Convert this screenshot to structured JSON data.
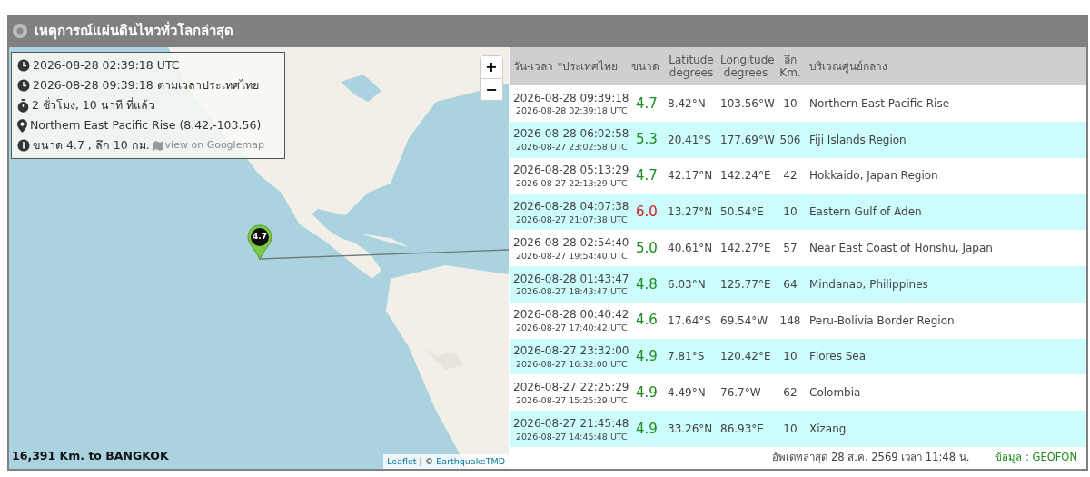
{
  "title": "เหตุการณ์แผ่นดินไหวทั่วโลกล่าสุด",
  "map": {
    "info": {
      "utc_time": "2026-08-28 02:39:18 UTC",
      "thai_time": "2026-08-28 09:39:18 ตามเวลาประเทศไทย",
      "elapsed": "2 ชั่วโมง, 10 นาที ที่แล้ว",
      "location": "Northern East Pacific Rise (8.42,-103.56)",
      "magnitude_depth": "ขนาด 4.7 , ลึก 10 กม.",
      "map_link": "view on Googlemap"
    },
    "zoom_in": "+",
    "zoom_out": "−",
    "marker_label": "4.7",
    "distance": "16,391 Km. to BANGKOK",
    "attribution_link": "Leaflet",
    "attribution_separator": "| ©",
    "attribution_source": "EarthquakeTMD"
  },
  "table": {
    "columns": [
      {
        "lines": [
          "วัน-เวลา *ประเทศไทย"
        ]
      },
      {
        "lines": [
          "ขนาด"
        ]
      },
      {
        "lines": [
          "Latitude",
          "degrees"
        ]
      },
      {
        "lines": [
          "Longitude",
          "degrees"
        ]
      },
      {
        "lines": [
          "ลึก",
          "Km."
        ]
      },
      {
        "lines": [
          "บริเวณศูนย์กลาง"
        ]
      }
    ],
    "rows": [
      {
        "local_time": "2026-08-28 09:39:18",
        "utc_time": "2026-08-28 02:39:18 UTC",
        "magnitude": "4.7",
        "color": "#1e8c1e",
        "latitude": "8.42°N",
        "longitude": "103.56°W",
        "depth": "10",
        "region": "Northern East Pacific Rise"
      },
      {
        "local_time": "2026-08-28 06:02:58",
        "utc_time": "2026-08-27 23:02:58 UTC",
        "magnitude": "5.3",
        "color": "#1e8c1e",
        "latitude": "20.41°S",
        "longitude": "177.69°W",
        "depth": "506",
        "region": "Fiji Islands Region"
      },
      {
        "local_time": "2026-08-28 05:13:29",
        "utc_time": "2026-08-27 22:13:29 UTC",
        "magnitude": "4.7",
        "color": "#1e8c1e",
        "latitude": "42.17°N",
        "longitude": "142.24°E",
        "depth": "42",
        "region": "Hokkaido, Japan Region"
      },
      {
        "local_time": "2026-08-28 04:07:38",
        "utc_time": "2026-08-27 21:07:38 UTC",
        "magnitude": "6.0",
        "color": "#cc1f1f",
        "latitude": "13.27°N",
        "longitude": "50.54°E",
        "depth": "10",
        "region": "Eastern Gulf of Aden"
      },
      {
        "local_time": "2026-08-28 02:54:40",
        "utc_time": "2026-08-27 19:54:40 UTC",
        "magnitude": "5.0",
        "color": "#1e8c1e",
        "latitude": "40.61°N",
        "longitude": "142.27°E",
        "depth": "57",
        "region": "Near East Coast of Honshu, Japan"
      },
      {
        "local_time": "2026-08-28 01:43:47",
        "utc_time": "2026-08-27 18:43:47 UTC",
        "magnitude": "4.8",
        "color": "#1e8c1e",
        "latitude": "6.03°N",
        "longitude": "125.77°E",
        "depth": "64",
        "region": "Mindanao, Philippines"
      },
      {
        "local_time": "2026-08-28 00:40:42",
        "utc_time": "2026-08-27 17:40:42 UTC",
        "magnitude": "4.6",
        "color": "#1e8c1e",
        "latitude": "17.64°S",
        "longitude": "69.54°W",
        "depth": "148",
        "region": "Peru-Bolivia Border Region"
      },
      {
        "local_time": "2026-08-27 23:32:00",
        "utc_time": "2026-08-27 16:32:00 UTC",
        "magnitude": "4.9",
        "color": "#1e8c1e",
        "latitude": "7.81°S",
        "longitude": "120.42°E",
        "depth": "10",
        "region": "Flores Sea"
      },
      {
        "local_time": "2026-08-27 22:25:29",
        "utc_time": "2026-08-27 15:25:29 UTC",
        "magnitude": "4.9",
        "color": "#1e8c1e",
        "latitude": "4.49°N",
        "longitude": "76.7°W",
        "depth": "62",
        "region": "Colombia"
      },
      {
        "local_time": "2026-08-27 21:45:48",
        "utc_time": "2026-08-27 14:45:48 UTC",
        "magnitude": "4.9",
        "color": "#1e8c1e",
        "latitude": "33.26°N",
        "longitude": "86.93°E",
        "depth": "10",
        "region": "Xizang"
      }
    ]
  },
  "footer": {
    "updated": "อัพเดทล่าสุด 28 ส.ค. 2569 เวลา 11:48 น.",
    "source": "ข้อมูล : GEOFON"
  }
}
